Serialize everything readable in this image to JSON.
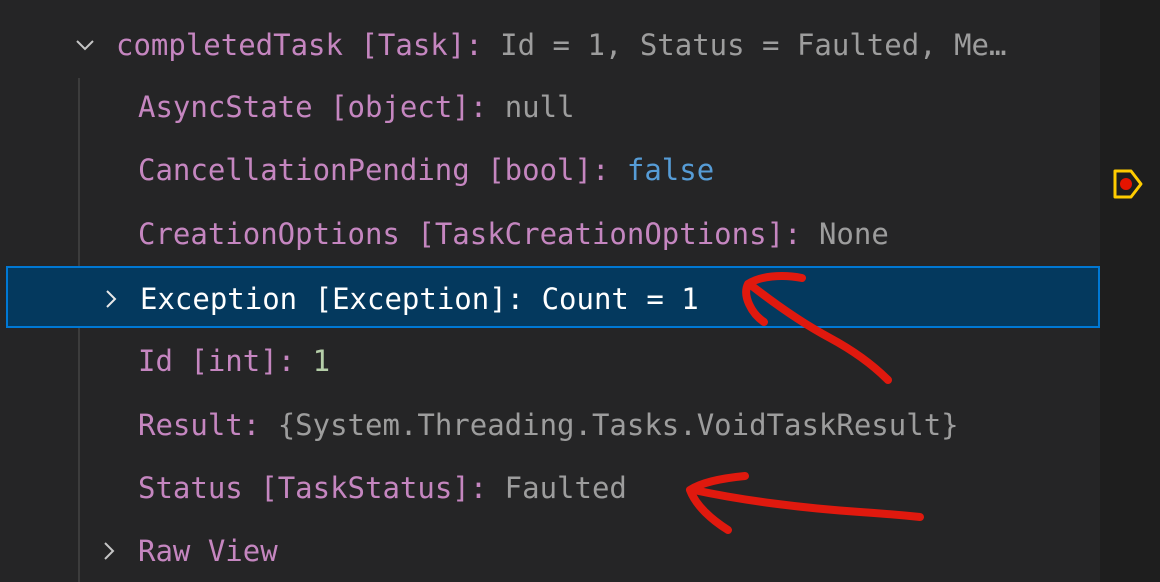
{
  "variables": {
    "root": {
      "name": "completedTask",
      "type": "[Task]",
      "value": "Id = 1, Status = Faulted, Me…"
    },
    "rows": [
      {
        "name": "AsyncState",
        "type": "[object]",
        "value": "null"
      },
      {
        "name": "CancellationPending",
        "type": "[bool]",
        "value": "false"
      },
      {
        "name": "CreationOptions",
        "type": "[TaskCreationOptions]",
        "value": "None"
      },
      {
        "name": "Exception",
        "type": "[Exception]",
        "value": "Count = 1"
      },
      {
        "name": "Id",
        "type": "[int]",
        "value": "1"
      },
      {
        "name": "Result",
        "value": "{System.Threading.Tasks.VoidTaskResult}"
      },
      {
        "name": "Status",
        "type": "[TaskStatus]",
        "value": "Faulted"
      },
      {
        "name": "Raw View"
      }
    ],
    "separator": ": "
  },
  "colors": {
    "name": "#c586c0",
    "value": "#9d9d9d",
    "boolean": "#569cd6",
    "number": "#b5cea8",
    "selection": "#04395e",
    "selection_border": "#0078d4",
    "annotation": "#e0190e",
    "breakpoint": "#ffcc00"
  },
  "icons": {
    "expanded": "chevron-down-icon",
    "collapsed": "chevron-right-icon",
    "breakpoint": "breakpoint-stopped-icon"
  }
}
